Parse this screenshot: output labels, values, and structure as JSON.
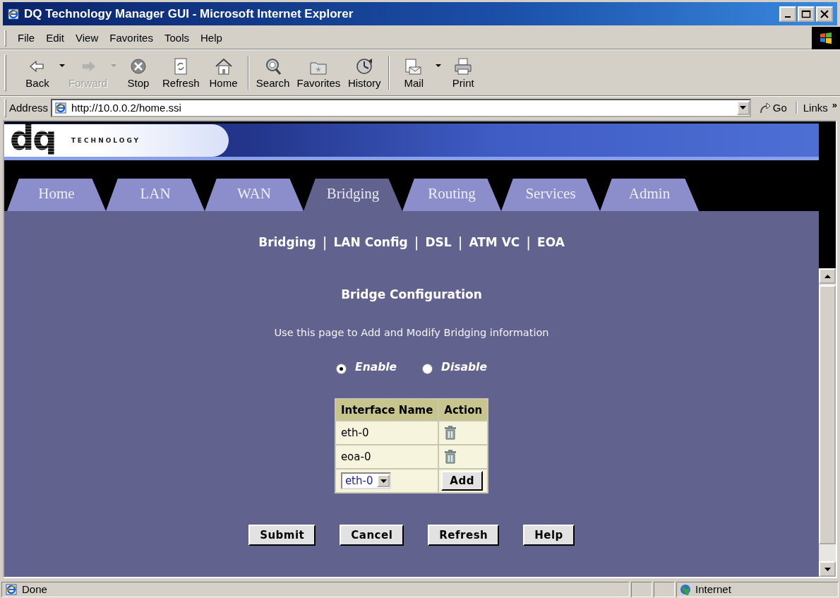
{
  "window": {
    "title": "DQ Technology Manager GUI - Microsoft Internet Explorer"
  },
  "menu": [
    "File",
    "Edit",
    "View",
    "Favorites",
    "Tools",
    "Help"
  ],
  "toolbar": [
    {
      "kind": "back",
      "label": "Back",
      "dropdown": true,
      "disabled": false
    },
    {
      "kind": "forward",
      "label": "Forward",
      "dropdown": true,
      "disabled": true
    },
    {
      "kind": "stop",
      "label": "Stop",
      "dropdown": false,
      "disabled": false
    },
    {
      "kind": "refresh",
      "label": "Refresh",
      "dropdown": false,
      "disabled": false
    },
    {
      "kind": "home",
      "label": "Home",
      "dropdown": false,
      "disabled": false
    },
    {
      "kind": "search",
      "label": "Search",
      "dropdown": false,
      "disabled": false
    },
    {
      "kind": "favorites",
      "label": "Favorites",
      "dropdown": false,
      "disabled": false
    },
    {
      "kind": "history",
      "label": "History",
      "dropdown": false,
      "disabled": false
    },
    {
      "kind": "mail",
      "label": "Mail",
      "dropdown": true,
      "disabled": false
    },
    {
      "kind": "print",
      "label": "Print",
      "dropdown": false,
      "disabled": false
    }
  ],
  "address": {
    "label": "Address",
    "url": "http://10.0.0.2/home.ssi",
    "go": "Go",
    "links": "Links",
    "more": "»"
  },
  "banner": {
    "logo_mark": "dq",
    "logo_text": "TECHNOLOGY"
  },
  "tabs": [
    {
      "label": "Home",
      "selected": false
    },
    {
      "label": "LAN",
      "selected": false
    },
    {
      "label": "WAN",
      "selected": false
    },
    {
      "label": "Bridging",
      "selected": true
    },
    {
      "label": "Routing",
      "selected": false
    },
    {
      "label": "Services",
      "selected": false
    },
    {
      "label": "Admin",
      "selected": false
    }
  ],
  "subnav": [
    {
      "kind": "link",
      "label": "Bridging"
    },
    {
      "kind": "separator",
      "label": "|"
    },
    {
      "kind": "link",
      "label": "LAN Config"
    },
    {
      "kind": "separator",
      "label": "|"
    },
    {
      "kind": "link",
      "label": "DSL"
    },
    {
      "kind": "separator",
      "label": "|"
    },
    {
      "kind": "link",
      "label": "ATM VC"
    },
    {
      "kind": "separator",
      "label": "|"
    },
    {
      "kind": "link",
      "label": "EOA"
    }
  ],
  "heading": "Bridge Configuration",
  "description": "Use this page to Add and Modify Bridging information",
  "bridge_mode": [
    {
      "label": "Enable",
      "selected": true
    },
    {
      "label": "Disable",
      "selected": false
    }
  ],
  "table": {
    "columns": [
      "Interface Name",
      "Action"
    ],
    "rows": [
      {
        "kind": "entry",
        "name": "eth-0"
      },
      {
        "kind": "entry",
        "name": "eoa-0"
      },
      {
        "kind": "add",
        "value": "eth-0",
        "button": "Add"
      }
    ]
  },
  "buttons": [
    "Submit",
    "Cancel",
    "Refresh",
    "Help"
  ],
  "status_bar": {
    "text": "Done",
    "zone": "Internet"
  }
}
